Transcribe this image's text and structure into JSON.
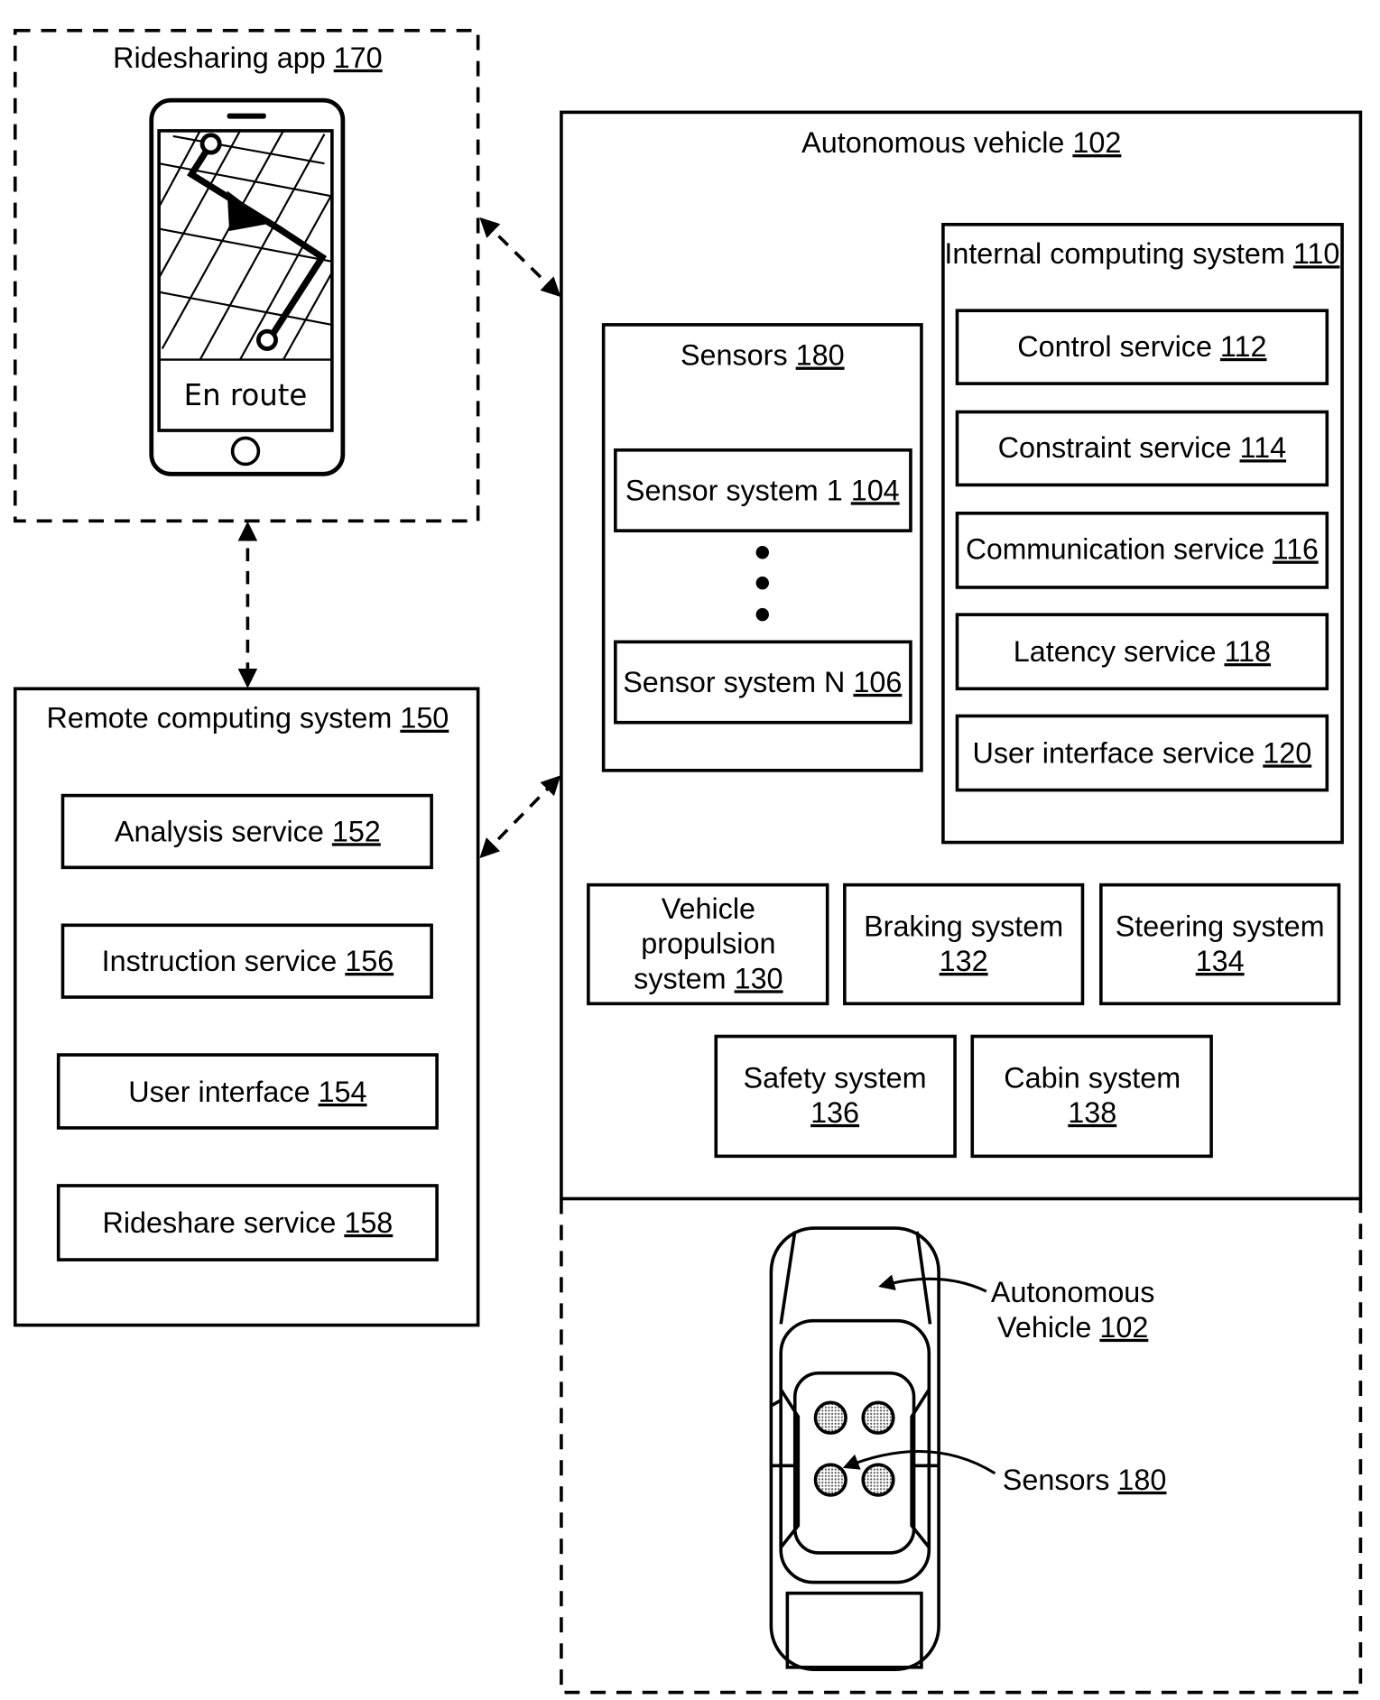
{
  "ridesharing_app": {
    "label": "Ridesharing app ",
    "num": "170",
    "phone_status": "En route"
  },
  "remote": {
    "label": "Remote computing system ",
    "num": "150",
    "services": [
      {
        "label": "Analysis service ",
        "num": "152"
      },
      {
        "label": "Instruction service ",
        "num": "156"
      },
      {
        "label": "User interface ",
        "num": "154"
      },
      {
        "label": "Rideshare service ",
        "num": "158"
      }
    ]
  },
  "av": {
    "label": "Autonomous vehicle ",
    "num": "102",
    "sensors": {
      "label": "Sensors ",
      "num": "180",
      "items": [
        {
          "label": "Sensor system 1 ",
          "num": "104"
        },
        {
          "label": "Sensor system N ",
          "num": "106"
        }
      ]
    },
    "internal": {
      "label": "Internal computing system ",
      "num": "110",
      "services": [
        {
          "label": "Control service ",
          "num": "112"
        },
        {
          "label": "Constraint service ",
          "num": "114"
        },
        {
          "label": "Communication service ",
          "num": "116"
        },
        {
          "label": "Latency service ",
          "num": "118"
        },
        {
          "label": "User interface service ",
          "num": "120"
        }
      ]
    },
    "systems": [
      {
        "line1": "Vehicle",
        "line2": "propulsion",
        "line3": "system ",
        "num": "130"
      },
      {
        "line1": "Braking system",
        "num": "132"
      },
      {
        "line1": "Steering system",
        "num": "134"
      },
      {
        "line1": "Safety system",
        "num": "136"
      },
      {
        "line1": "Cabin system",
        "num": "138"
      }
    ]
  },
  "car_labels": {
    "vehicle_line1": "Autonomous",
    "vehicle_line2": "Vehicle ",
    "vehicle_num": "102",
    "sensors_label": "Sensors ",
    "sensors_num": "180"
  }
}
